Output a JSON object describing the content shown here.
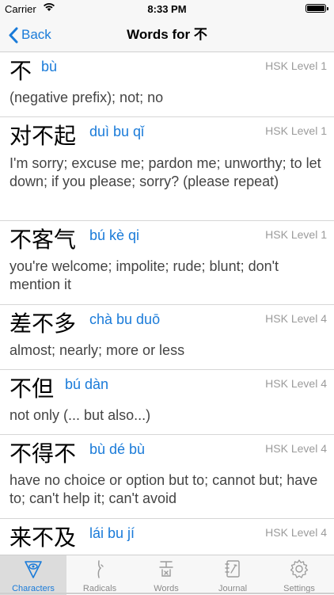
{
  "status": {
    "carrier": "Carrier",
    "time": "8:33 PM"
  },
  "nav": {
    "back_label": "Back",
    "title": "Words for 不"
  },
  "words": [
    {
      "hanzi": "不",
      "pinyin": "bù",
      "level": "HSK Level 1",
      "definition": "(negative prefix); not; no"
    },
    {
      "hanzi": "对不起",
      "pinyin": "duì bu qǐ",
      "level": "HSK Level 1",
      "definition": "I'm sorry; excuse me; pardon me; unworthy; to let down; if you please; sorry? (please repeat)"
    },
    {
      "hanzi": "不客气",
      "pinyin": "bú kè qi",
      "level": "HSK Level 1",
      "definition": "you're welcome; impolite; rude; blunt; don't mention it"
    },
    {
      "hanzi": "差不多",
      "pinyin": "chà bu duō",
      "level": "HSK Level 4",
      "definition": "almost; nearly; more or less"
    },
    {
      "hanzi": "不但",
      "pinyin": "bú dàn",
      "level": "HSK Level 4",
      "definition": "not only (... but also...)"
    },
    {
      "hanzi": "不得不",
      "pinyin": "bù dé bù",
      "level": "HSK Level 4",
      "definition": "have no choice or option but to; cannot but; have to; can't help it; can't avoid"
    },
    {
      "hanzi": "来不及",
      "pinyin": "lái bu jí",
      "level": "HSK Level 4",
      "definition": ""
    }
  ],
  "tabs": [
    {
      "label": "Characters",
      "icon": "characters-icon",
      "active": true
    },
    {
      "label": "Radicals",
      "icon": "radicals-icon",
      "active": false
    },
    {
      "label": "Words",
      "icon": "words-icon",
      "active": false
    },
    {
      "label": "Journal",
      "icon": "journal-icon",
      "active": false
    },
    {
      "label": "Settings",
      "icon": "settings-icon",
      "active": false
    }
  ],
  "colors": {
    "accent": "#1a7bd9",
    "muted": "#9b9b9b",
    "bar_bg": "#f7f7f7"
  }
}
